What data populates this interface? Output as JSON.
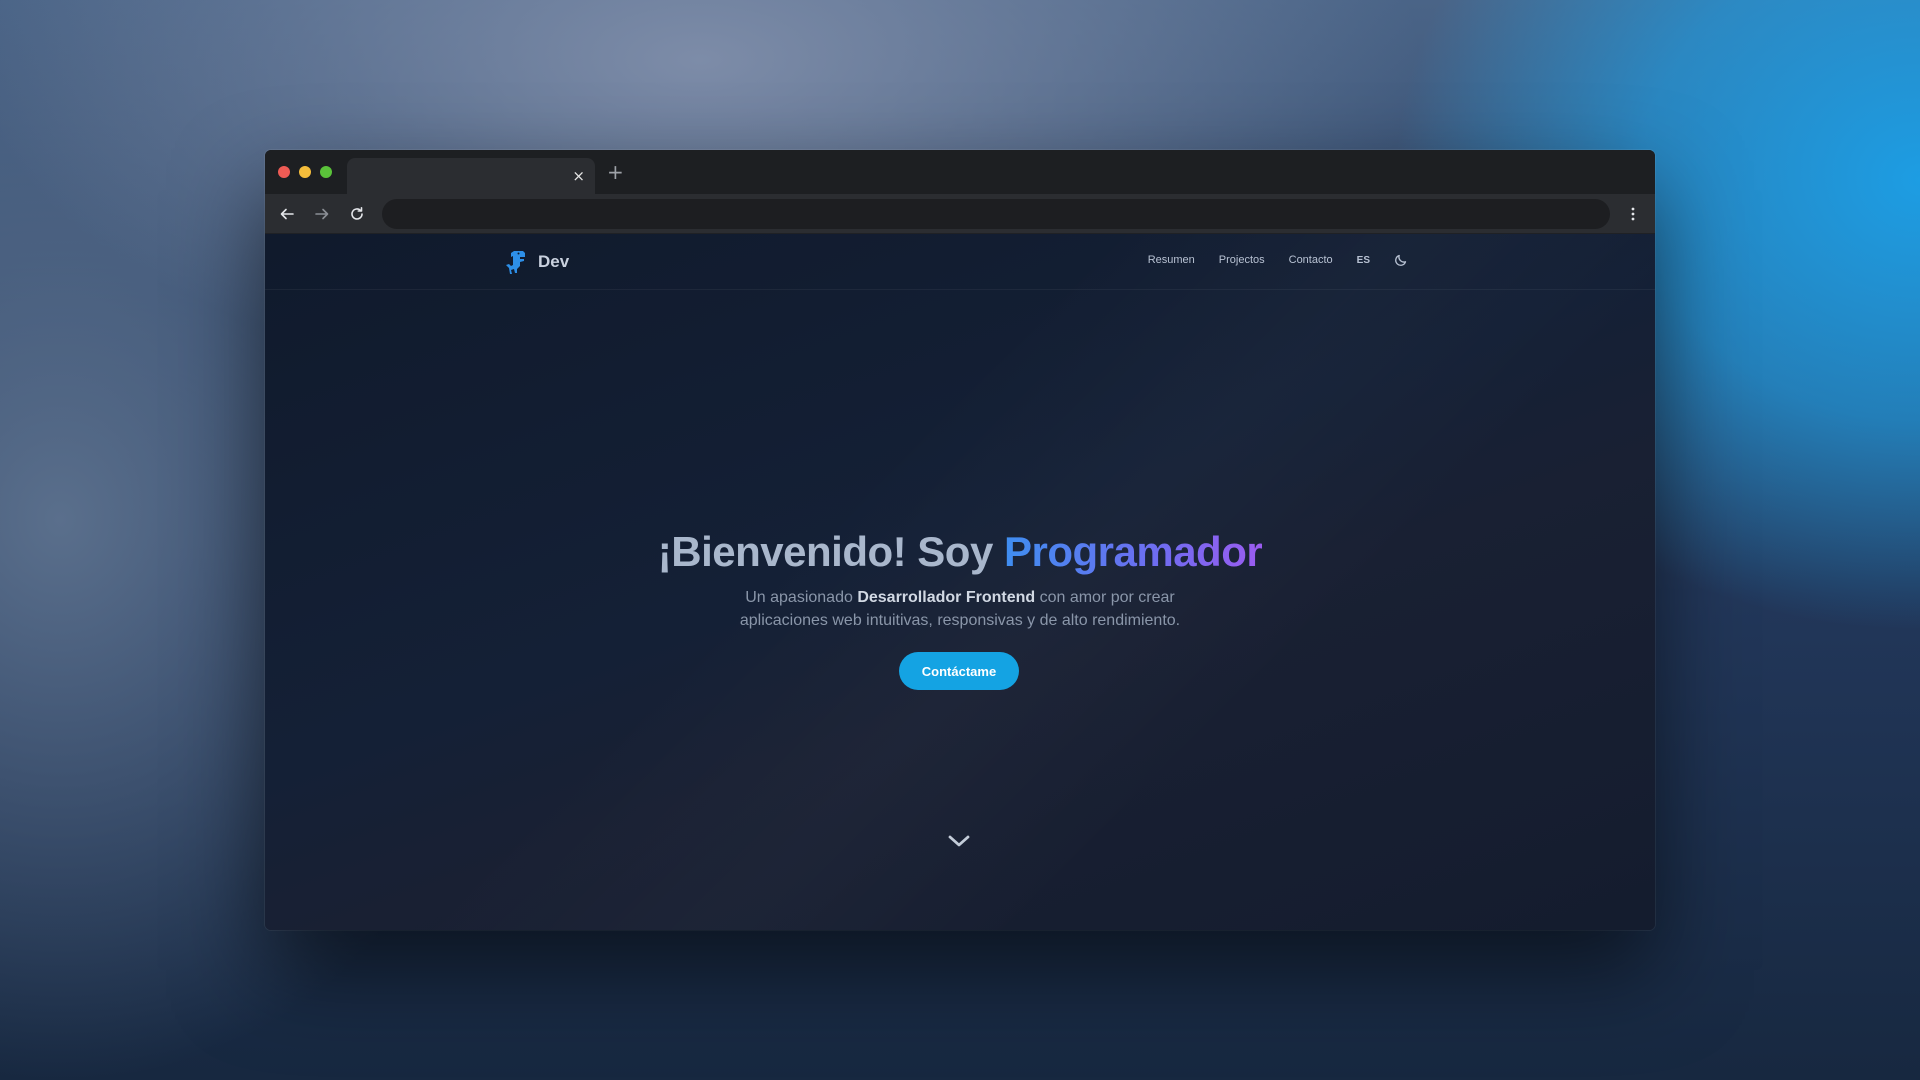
{
  "browser": {
    "tab_close": "×",
    "new_tab": "+"
  },
  "site": {
    "logo_text": "Dev",
    "nav": [
      "Resumen",
      "Projectos",
      "Contacto"
    ],
    "lang": "ES"
  },
  "hero": {
    "title_prefix": "¡Bienvenido! Soy ",
    "title_accent": "Programador",
    "sub_before": "Un apasionado ",
    "sub_bold": "Desarrollador Frontend",
    "sub_after": " con amor por crear",
    "sub_line2": "aplicaciones web intuitivas, responsivas y de alto rendimiento.",
    "cta_label": "Contáctame"
  },
  "colors": {
    "accent": "#14a3e3",
    "page_bg": "#141c2e"
  },
  "icons": {
    "back": "arrow-left-icon",
    "forward": "arrow-right-icon",
    "reload": "reload-icon",
    "menu": "kebab-menu-icon",
    "theme": "moon-icon",
    "logo": "dinosaur-icon",
    "scroll": "chevron-down-icon"
  }
}
